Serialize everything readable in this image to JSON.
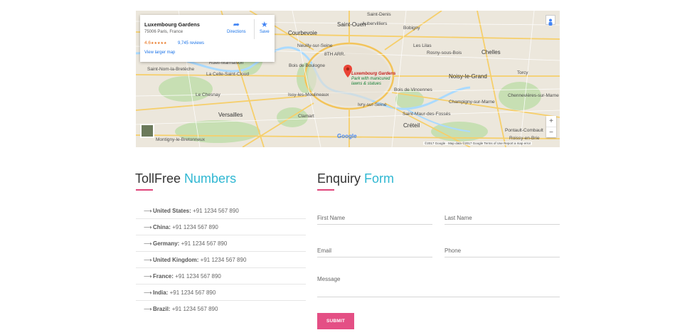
{
  "map": {
    "info_card": {
      "title": "Luxembourg Gardens",
      "address": "75006 Paris, France",
      "rating": "4.6",
      "stars": "★★★★★",
      "reviews": "9,745 reviews",
      "larger_map": "View larger map",
      "directions": "Directions",
      "save": "Save"
    },
    "marker": {
      "title": "Luxembourg Gardens",
      "subtitle_1": "Park with manicured",
      "subtitle_2": "lawns & statues"
    },
    "places": {
      "saint_denis": "Saint-Denis",
      "courbevoie": "Courbevoie",
      "saint_ouen": "Saint-Ouen",
      "aubervilliers": "Aubervilliers",
      "bobigny": "Bobigny",
      "les_lilas": "Les Lilas",
      "neuilly": "Neuilly-sur-Seine",
      "arr_8": "8TH ARR.",
      "rosny": "Rosny-sous-Bois",
      "chelles": "Chelles",
      "st_nom": "Saint-Nom-la-Bretèche",
      "rueil": "Rueil-Malmaison",
      "bois_boulogne": "Bois de Boulogne",
      "la_celle": "La Celle-Saint-Cloud",
      "noisy": "Noisy-le-Grand",
      "torcy": "Torcy",
      "chesnay": "Le Chesnay",
      "bois_vincennes": "Bois de Vincennes",
      "issy": "Issy-les-Moulineaux",
      "ivry": "Ivry-sur-Seine",
      "chennevieres": "Chennevières-sur-Marne",
      "champigny": "Champigny-sur-Marne",
      "versailles": "Versailles",
      "clamart": "Clamart",
      "st_maur": "Saint-Maur-des-Fossés",
      "creteil": "Créteil",
      "pontault": "Pontault-Combault",
      "roissy": "Roissy-en-Brie",
      "montigny": "Montigny-le-Bretonneux"
    },
    "attribution": "©2017 Google · Map data ©2017 Google   Terms of Use   Report a map error",
    "google": "Google",
    "zoom_in": "+",
    "zoom_out": "−"
  },
  "tollfree": {
    "title_plain": "TollFree",
    "title_accent": "Numbers",
    "arrow": "⟶",
    "items": [
      {
        "country": "United States:",
        "number": "+91 1234 567 890"
      },
      {
        "country": "China:",
        "number": "+91 1234 567 890"
      },
      {
        "country": "Germany:",
        "number": "+91 1234 567 890"
      },
      {
        "country": "United Kingdom:",
        "number": "+91 1234 567 890"
      },
      {
        "country": "France:",
        "number": "+91 1234 567 890"
      },
      {
        "country": "India:",
        "number": "+91 1234 567 890"
      },
      {
        "country": "Brazil:",
        "number": "+91 1234 567 890"
      }
    ]
  },
  "enquiry": {
    "title_plain": "Enquiry",
    "title_accent": "Form",
    "first_name_placeholder": "First Name",
    "last_name_placeholder": "Last Name",
    "email_placeholder": "Email",
    "phone_placeholder": "Phone",
    "message_placeholder": "Message",
    "submit_label": "SUBMIT"
  },
  "colors": {
    "accent_blue": "#2fb7d2",
    "accent_pink": "#e0457b",
    "submit_bg": "#e44f85"
  }
}
